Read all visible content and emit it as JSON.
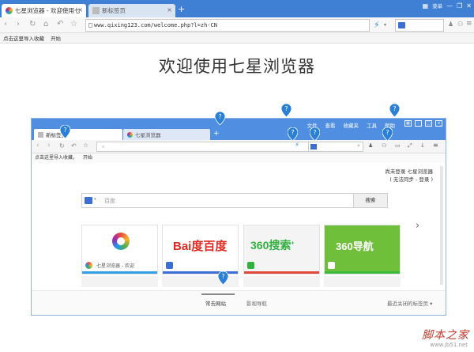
{
  "browser": {
    "tabs": [
      {
        "title": "七星浏览器 - 欢迎使用七",
        "active": true
      },
      {
        "title": "新标签页",
        "active": false
      }
    ],
    "window_buttons": [
      "最小化",
      "还原",
      "关闭"
    ],
    "menu_label": "菜单",
    "url": "www.qixing123.com/welcome.php?l=zh-CN",
    "bookmarks": [
      "点击这里导入收藏",
      "开始"
    ]
  },
  "page": {
    "headline": "欢迎使用七星浏览器"
  },
  "screenshot": {
    "tabs": [
      {
        "title": "新标签页"
      },
      {
        "title": "七星浏览器"
      }
    ],
    "menu": [
      "文件",
      "查看",
      "收藏夹",
      "工具",
      "帮助"
    ],
    "bookmarks": [
      "点击这里导入收藏。",
      "开始"
    ],
    "login_line1": "尚未登录 七星浏览器",
    "login_line2": "( 无法同步 - 登录 )",
    "search_placeholder": "百度",
    "search_button": "搜索",
    "tiles": [
      {
        "label": "七星浏览器 - 欢迎",
        "brand": "",
        "bar": "#35a0e8",
        "bg": "#ffffff"
      },
      {
        "label": "",
        "brand": "Bai度百度",
        "bar": "#3d6fd6",
        "bg": "#ffffff"
      },
      {
        "label": "",
        "brand": "360搜索",
        "bar": "#e04a3c",
        "bg": "#f4f4f4"
      },
      {
        "label": "",
        "brand": "360导航",
        "bar": "#3cba3c",
        "bg": "#6fbf3b"
      }
    ],
    "footer_tabs": [
      "常去网站",
      "影视导航"
    ],
    "recent_closed": "最近关闭的标签页",
    "next_arrow": "›"
  },
  "watermark": {
    "brand": "脚本之家",
    "url": "www.jb51.net"
  }
}
